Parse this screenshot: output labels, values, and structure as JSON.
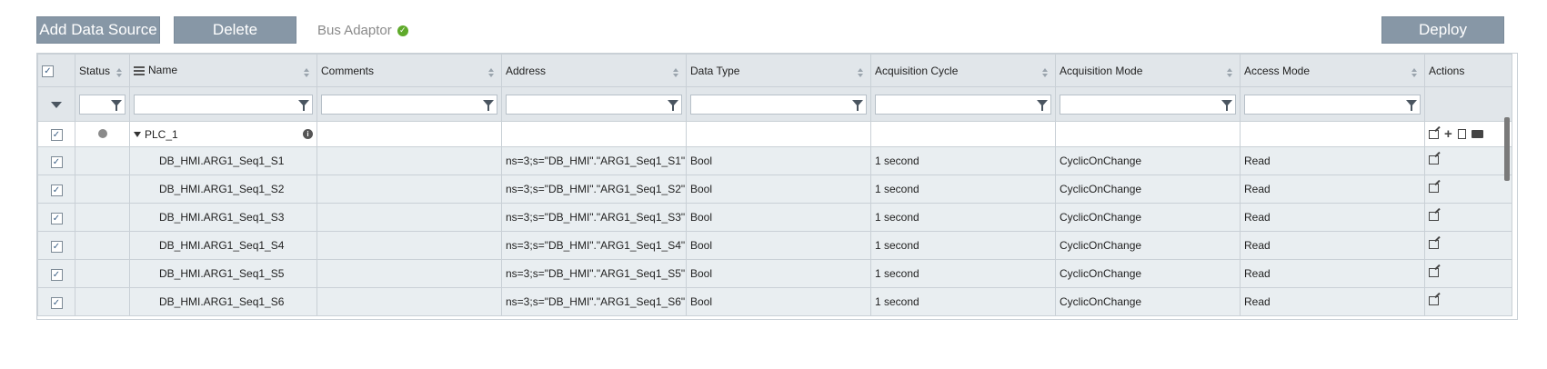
{
  "toolbar": {
    "add_label": "Add Data Source",
    "delete_label": "Delete",
    "bus_label": "Bus Adaptor",
    "deploy_label": "Deploy"
  },
  "columns": [
    "Status",
    "Name",
    "Comments",
    "Address",
    "Data Type",
    "Acquisition Cycle",
    "Acquisition Mode",
    "Access Mode",
    "Actions"
  ],
  "group": {
    "name": "PLC_1"
  },
  "rows": [
    {
      "name": "DB_HMI.ARG1_Seq1_S1",
      "address": "ns=3;s=\"DB_HMI\".\"ARG1_Seq1_S1\"",
      "type": "Bool",
      "cycle": "1 second",
      "mode": "CyclicOnChange",
      "access": "Read"
    },
    {
      "name": "DB_HMI.ARG1_Seq1_S2",
      "address": "ns=3;s=\"DB_HMI\".\"ARG1_Seq1_S2\"",
      "type": "Bool",
      "cycle": "1 second",
      "mode": "CyclicOnChange",
      "access": "Read"
    },
    {
      "name": "DB_HMI.ARG1_Seq1_S3",
      "address": "ns=3;s=\"DB_HMI\".\"ARG1_Seq1_S3\"",
      "type": "Bool",
      "cycle": "1 second",
      "mode": "CyclicOnChange",
      "access": "Read"
    },
    {
      "name": "DB_HMI.ARG1_Seq1_S4",
      "address": "ns=3;s=\"DB_HMI\".\"ARG1_Seq1_S4\"",
      "type": "Bool",
      "cycle": "1 second",
      "mode": "CyclicOnChange",
      "access": "Read"
    },
    {
      "name": "DB_HMI.ARG1_Seq1_S5",
      "address": "ns=3;s=\"DB_HMI\".\"ARG1_Seq1_S5\"",
      "type": "Bool",
      "cycle": "1 second",
      "mode": "CyclicOnChange",
      "access": "Read"
    },
    {
      "name": "DB_HMI.ARG1_Seq1_S6",
      "address": "ns=3;s=\"DB_HMI\".\"ARG1_Seq1_S6\"",
      "type": "Bool",
      "cycle": "1 second",
      "mode": "CyclicOnChange",
      "access": "Read"
    }
  ],
  "colors": {
    "button": "#8797a6",
    "header_bg": "#e1e6ea",
    "row_bg": "#e9eef1",
    "ok_green": "#5faa2b"
  }
}
